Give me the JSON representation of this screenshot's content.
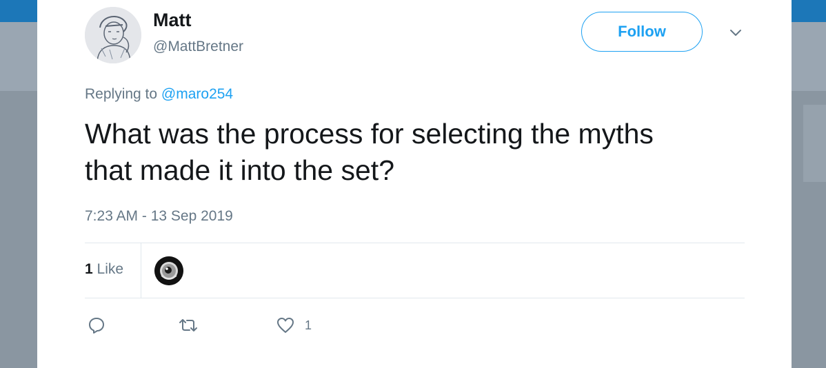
{
  "user": {
    "name": "Matt",
    "handle": "@MattBretner"
  },
  "follow_label": "Follow",
  "reply": {
    "prefix": "Replying to",
    "mention": "@maro254"
  },
  "tweet": {
    "text": "What was the process for selecting the myths that made it into the set?",
    "timestamp": "7:23 AM - 13 Sep 2019"
  },
  "stats": {
    "likes_count": "1",
    "likes_label": "Like"
  },
  "actions": {
    "like_count": "1"
  },
  "colors": {
    "accent": "#1da1f2",
    "text": "#14171a",
    "muted": "#657786",
    "divider": "#e1e8ed"
  },
  "icons": {
    "reply": "reply-icon",
    "retweet": "retweet-icon",
    "like": "heart-icon",
    "more": "chevron-down-icon"
  }
}
